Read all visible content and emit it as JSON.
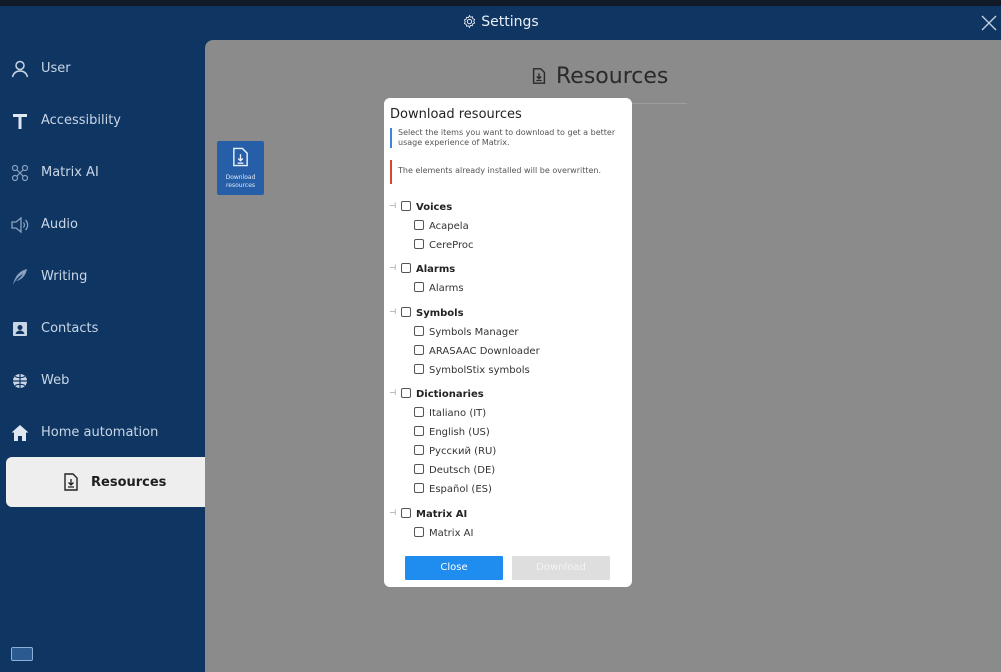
{
  "window": {
    "title": "Settings"
  },
  "sidebar": {
    "items": [
      {
        "label": "User",
        "icon": "user-icon"
      },
      {
        "label": "Accessibility",
        "icon": "accessibility-icon"
      },
      {
        "label": "Matrix AI",
        "icon": "matrix-ai-icon"
      },
      {
        "label": "Audio",
        "icon": "speaker-icon"
      },
      {
        "label": "Writing",
        "icon": "feather-icon"
      },
      {
        "label": "Contacts",
        "icon": "contacts-icon"
      },
      {
        "label": "Web",
        "icon": "globe-icon"
      },
      {
        "label": "Home automation",
        "icon": "home-icon"
      },
      {
        "label": "Resources",
        "icon": "download-file-icon",
        "active": true
      }
    ]
  },
  "main": {
    "title": "Resources",
    "tile": {
      "label_line1": "Download",
      "label_line2": "resources"
    }
  },
  "dialog": {
    "title": "Download resources",
    "info_text": "Select the items you want to download to get a better usage experience of Matrix.",
    "warning_text": "The elements already installed will be overwritten.",
    "groups": [
      {
        "label": "Voices",
        "checked": false,
        "items": [
          {
            "label": "Acapela",
            "checked": false
          },
          {
            "label": "CereProc",
            "checked": false
          }
        ]
      },
      {
        "label": "Alarms",
        "checked": false,
        "items": [
          {
            "label": "Alarms",
            "checked": false
          }
        ]
      },
      {
        "label": "Symbols",
        "checked": false,
        "items": [
          {
            "label": "Symbols Manager",
            "checked": false
          },
          {
            "label": "ARASAAC Downloader",
            "checked": false
          },
          {
            "label": "SymbolStix symbols",
            "checked": false
          }
        ]
      },
      {
        "label": "Dictionaries",
        "checked": false,
        "items": [
          {
            "label": "Italiano (IT)",
            "checked": false
          },
          {
            "label": "English (US)",
            "checked": false
          },
          {
            "label": "Русский (RU)",
            "checked": false
          },
          {
            "label": "Deutsch (DE)",
            "checked": false
          },
          {
            "label": "Español (ES)",
            "checked": false
          }
        ]
      },
      {
        "label": "Matrix AI",
        "checked": false,
        "items": [
          {
            "label": "Matrix AI",
            "checked": false
          }
        ]
      }
    ],
    "close_label": "Close",
    "download_label": "Download",
    "download_enabled": false
  },
  "colors": {
    "sidebar_bg": "#0f3563",
    "main_bg": "#8b8b8b",
    "accent": "#1f8cf0",
    "tile": "#265fa8",
    "info_bar": "#3a87d9",
    "warning_bar": "#d9452f"
  }
}
